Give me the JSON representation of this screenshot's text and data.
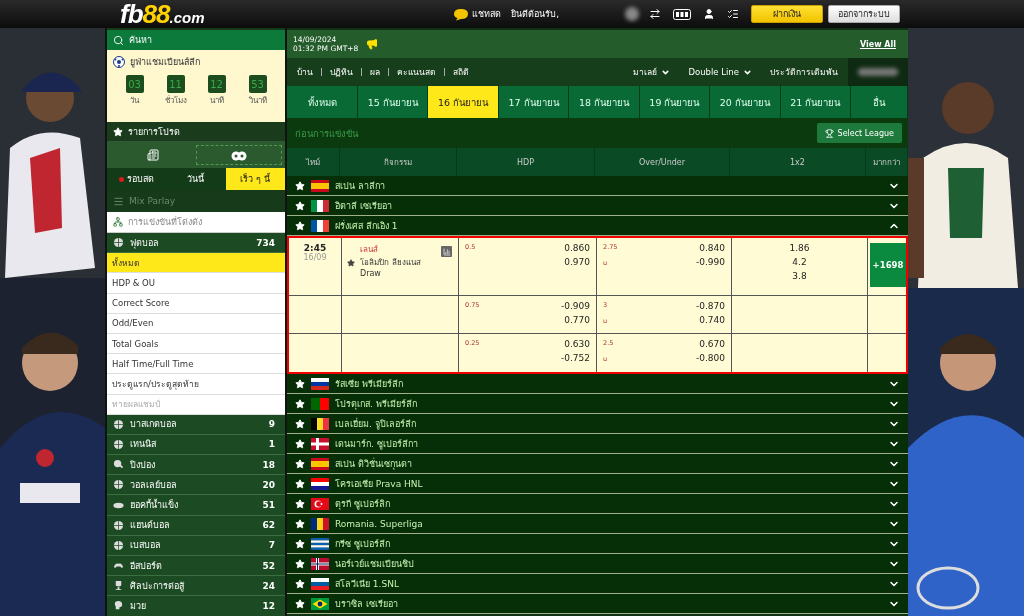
{
  "header": {
    "logo": {
      "main": "fb",
      "accent": "88",
      "suffix": ".com"
    },
    "chat": "แชทสด",
    "welcome": "ยินดีต้อนรับ,",
    "deposit": "ฝากเงิน",
    "logout": "ออกจากระบบ"
  },
  "sidebar": {
    "search": "ค้นหา",
    "promo": {
      "title": "ยูฟ่าแชมเปียนส์ลีก",
      "countdown": [
        {
          "value": "03",
          "unit": "วัน"
        },
        {
          "value": "11",
          "unit": "ชั่วโมง"
        },
        {
          "value": "12",
          "unit": "นาที"
        },
        {
          "value": "53",
          "unit": "วินาที"
        }
      ]
    },
    "favorites": "รายการโปรด",
    "view_tabs": [
      {
        "kind": "list",
        "selected": false
      },
      {
        "kind": "ball",
        "selected": true
      }
    ],
    "time_tabs": [
      {
        "label": "รอบสด",
        "live": true,
        "selected": false
      },
      {
        "label": "วันนี้",
        "live": false,
        "selected": false
      },
      {
        "label": "เร็ว ๆ นี้",
        "live": false,
        "selected": true
      }
    ],
    "mix_parlay": {
      "label": "Mix Parlay",
      "disabled": true
    },
    "popular": "การแข่งขันที่โด่งดัง",
    "sports": [
      {
        "kind": "football",
        "name": "ฟุตบอล",
        "count": "734",
        "markets": [
          {
            "label": "ทั้งหมด",
            "selected": true,
            "disabled": false
          },
          {
            "label": "HDP & OU",
            "selected": false,
            "disabled": false
          },
          {
            "label": "Correct Score",
            "selected": false,
            "disabled": false
          },
          {
            "label": "Odd/Even",
            "selected": false,
            "disabled": false
          },
          {
            "label": "Total Goals",
            "selected": false,
            "disabled": false
          },
          {
            "label": "Half Time/Full Time",
            "selected": false,
            "disabled": false
          },
          {
            "label": "ประตูแรก/ประตูสุดท้าย",
            "selected": false,
            "disabled": false
          },
          {
            "label": "ทายผลแชมป์",
            "selected": false,
            "disabled": true
          }
        ]
      },
      {
        "kind": "basketball",
        "name": "บาสเกตบอล",
        "count": "9"
      },
      {
        "kind": "tennis",
        "name": "เทนนิส",
        "count": "1"
      },
      {
        "kind": "table_tennis",
        "name": "ปิงปอง",
        "count": "18"
      },
      {
        "kind": "volleyball",
        "name": "วอลเลย์บอล",
        "count": "20"
      },
      {
        "kind": "hockey",
        "name": "ฮอคกี้น้ำแข็ง",
        "count": "51"
      },
      {
        "kind": "handball",
        "name": "แฮนด์บอล",
        "count": "62"
      },
      {
        "kind": "baseball",
        "name": "เบสบอล",
        "count": "7"
      },
      {
        "kind": "esports",
        "name": "อีสปอร์ต",
        "count": "52"
      },
      {
        "kind": "martial",
        "name": "ศิลปะการต่อสู้",
        "count": "24"
      },
      {
        "kind": "boxing",
        "name": "มวย",
        "count": "12"
      }
    ]
  },
  "main": {
    "date": "14/09/2024",
    "time": "01:32 PM GMT+8",
    "view_all": "View All",
    "nav": [
      "บ้าน",
      "ปฏิทิน",
      "ผล",
      "คะแนนสด",
      "สถิติ"
    ],
    "odds_format": "มาเลย์",
    "line_mode": "Double Line",
    "bet_history": "ประวัติการเดิมพัน",
    "date_tabs": [
      {
        "label": "ทั้งหมด",
        "selected": false
      },
      {
        "label": "15 กันยายน",
        "selected": false
      },
      {
        "label": "16 กันยายน",
        "selected": true
      },
      {
        "label": "17 กันยายน",
        "selected": false
      },
      {
        "label": "18 กันยายน",
        "selected": false
      },
      {
        "label": "19 กันยายน",
        "selected": false
      },
      {
        "label": "20 กันยายน",
        "selected": false
      },
      {
        "label": "21 กันยายน",
        "selected": false
      },
      {
        "label": "อื่น",
        "selected": false
      }
    ],
    "section": "ก่อนการแข่งขัน",
    "select_league": "Select League",
    "columns": [
      "ไทม์",
      "กิจกรรม",
      "HDP",
      "Over/Under",
      "1x2",
      "มากกว่า"
    ],
    "leagues": [
      {
        "name": "สเปน ลาลีกา",
        "kind": "es",
        "expanded": false
      },
      {
        "name": "อิตาลี เซเรียอา",
        "kind": "it",
        "expanded": false
      },
      {
        "name": "ฝรั่งเศส ลีกเอิง 1",
        "kind": "fr",
        "expanded": true,
        "matches": [
          {
            "time": "2:45",
            "date": "16/09",
            "home": "เลนส์",
            "away": "โอลิมปิก ลียงแนส",
            "draw": "Draw",
            "more": "+1698",
            "x12": [
              "1.86",
              "4.2",
              "3.8"
            ],
            "lines": [
              {
                "hdp": "0.5",
                "hdp_home": "0.860",
                "hdp_away": "0.970",
                "ou": "2.75",
                "ou_side": "u",
                "ou_over": "0.840",
                "ou_under": "-0.990"
              },
              {
                "hdp": "0.75",
                "hdp_home": "-0.909",
                "hdp_away": "0.770",
                "ou": "3",
                "ou_side": "u",
                "ou_over": "-0.870",
                "ou_under": "0.740"
              },
              {
                "hdp": "0.25",
                "hdp_home": "0.630",
                "hdp_away": "-0.752",
                "ou": "2.5",
                "ou_side": "u",
                "ou_over": "0.670",
                "ou_under": "-0.800"
              }
            ]
          }
        ]
      },
      {
        "name": "รัสเซีย พรีเมียร์ลีก",
        "kind": "ru",
        "expanded": false
      },
      {
        "name": "โปรตุเกส. พรีเมียร์ลีก",
        "kind": "pt",
        "expanded": false
      },
      {
        "name": "เบลเยี่ยม. จูปิเลอร์ลีก",
        "kind": "be",
        "expanded": false
      },
      {
        "name": "เดนมาร์ก. ซูเปอร์ลีกา",
        "kind": "dk",
        "expanded": false
      },
      {
        "name": "สเปน ดิวิชั่นเซกุนดา",
        "kind": "es",
        "expanded": false
      },
      {
        "name": "โครเอเชีย Prava HNL",
        "kind": "hr",
        "expanded": false
      },
      {
        "name": "ตุรกี ซูเปอร์ลิก",
        "kind": "tr",
        "expanded": false
      },
      {
        "name": "Romania. Superliga",
        "kind": "ro",
        "expanded": false
      },
      {
        "name": "กรีซ ซูเปอร์ลีก",
        "kind": "gr",
        "expanded": false
      },
      {
        "name": "นอร์เวย์แชมเปียนชิป",
        "kind": "no",
        "expanded": false
      },
      {
        "name": "สโลวีเนีย 1.SNL",
        "kind": "si",
        "expanded": false
      },
      {
        "name": "บราซิล เซเรียอา",
        "kind": "br",
        "expanded": false
      }
    ]
  }
}
